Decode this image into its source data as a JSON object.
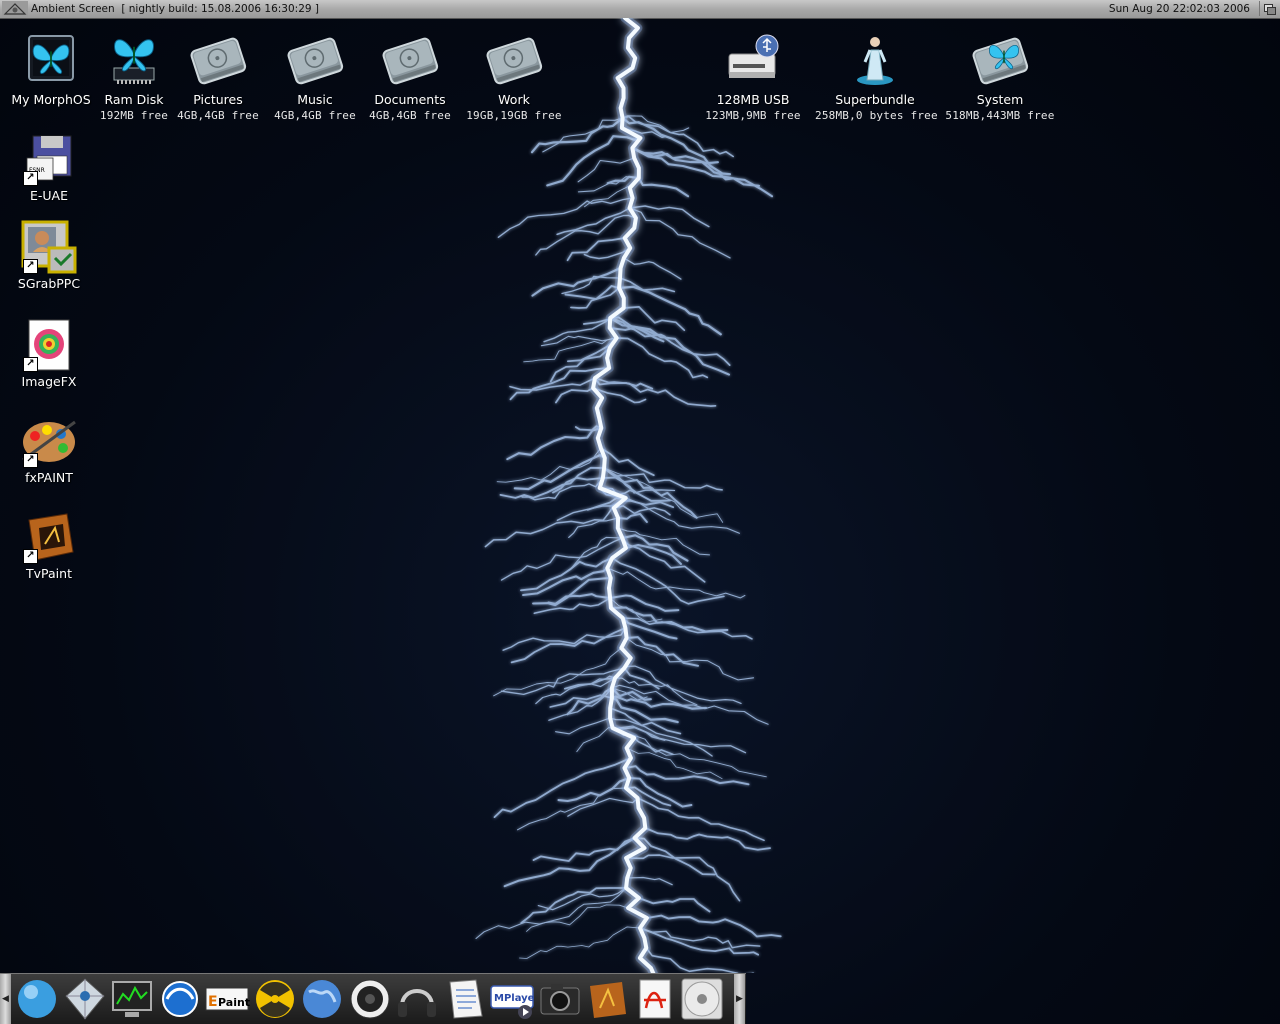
{
  "screen": {
    "title": "Ambient Screen  [ nightly build: 15.08.2006 16:30:29 ]",
    "clock": "Sun Aug 20 22:02:03 2006"
  },
  "top_icons": [
    {
      "name": "My MorphOS",
      "sub": "",
      "icon": "morphos-butterfly-cube-icon"
    },
    {
      "name": "Ram Disk",
      "sub": "192MB free",
      "icon": "ram-disk-butterfly-icon"
    },
    {
      "name": "Pictures",
      "sub": "4GB,4GB free",
      "icon": "hard-drive-icon"
    },
    {
      "name": "Music",
      "sub": "4GB,4GB free",
      "icon": "hard-drive-icon"
    },
    {
      "name": "Documents",
      "sub": "4GB,4GB free",
      "icon": "hard-drive-icon"
    },
    {
      "name": "Work",
      "sub": "19GB,19GB free",
      "icon": "hard-drive-icon"
    },
    {
      "name": "128MB USB",
      "sub": "123MB,9MB free",
      "icon": "usb-drive-icon"
    },
    {
      "name": "Superbundle",
      "sub": "258MB,0 bytes free",
      "icon": "superbundle-figure-icon"
    },
    {
      "name": "System",
      "sub": "518MB,443MB free",
      "icon": "system-drive-butterfly-icon"
    }
  ],
  "left_icons": [
    {
      "name": "E-UAE",
      "icon": "floppy-disk-icon"
    },
    {
      "name": "SGrabPPC",
      "icon": "screen-grabber-icon"
    },
    {
      "name": "ImageFX",
      "icon": "imagefx-icon"
    },
    {
      "name": "fxPAINT",
      "icon": "paint-palette-icon"
    },
    {
      "name": "TvPaint",
      "icon": "tvpaint-icon"
    }
  ],
  "dock": {
    "items": [
      {
        "icon": "globe-orb-icon"
      },
      {
        "icon": "diamond-icon"
      },
      {
        "icon": "monitor-icon"
      },
      {
        "icon": "browser-globe-icon"
      },
      {
        "icon": "epaint-icon",
        "text": "Paint"
      },
      {
        "icon": "radiation-icon"
      },
      {
        "icon": "earth-globe-icon"
      },
      {
        "icon": "speaker-icon"
      },
      {
        "icon": "headphones-icon"
      },
      {
        "icon": "text-editor-icon"
      },
      {
        "icon": "mplayer-icon",
        "text": "MPlayer"
      },
      {
        "icon": "camera-icon"
      },
      {
        "icon": "tvpaint-dock-icon"
      },
      {
        "icon": "pdf-reader-icon"
      },
      {
        "icon": "cd-disc-icon"
      }
    ]
  },
  "colors": {
    "background": "#040914",
    "titlebar": "#b0b0b0",
    "lightning": "#e8f4ff",
    "butterfly": "#29b6e6"
  }
}
